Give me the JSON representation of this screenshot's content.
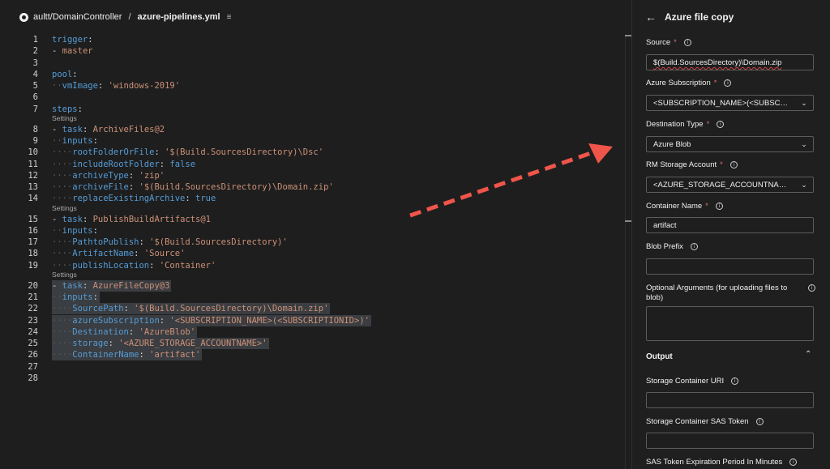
{
  "breadcrumb": {
    "repo": "aultt/DomainController",
    "separator": "/",
    "file": "azure-pipelines.yml"
  },
  "editor": {
    "lines": [
      {
        "n": "1",
        "tokens": [
          [
            "k",
            "trigger"
          ],
          [
            "p",
            ":"
          ]
        ]
      },
      {
        "n": "2",
        "tokens": [
          [
            "p",
            "- "
          ],
          [
            "s",
            "master"
          ]
        ]
      },
      {
        "n": "3",
        "tokens": []
      },
      {
        "n": "4",
        "tokens": [
          [
            "k",
            "pool"
          ],
          [
            "p",
            ":"
          ]
        ]
      },
      {
        "n": "5",
        "tokens": [
          [
            "g",
            "··"
          ],
          [
            "k",
            "vmImage"
          ],
          [
            "p",
            ": "
          ],
          [
            "s",
            "'windows-2019'"
          ]
        ]
      },
      {
        "n": "6",
        "tokens": []
      },
      {
        "n": "7",
        "tokens": [
          [
            "k",
            "steps"
          ],
          [
            "p",
            ":"
          ]
        ]
      },
      {
        "n": "8",
        "tokens": [
          [
            "p",
            "- "
          ],
          [
            "k",
            "task"
          ],
          [
            "p",
            ": "
          ],
          [
            "s",
            "ArchiveFiles@2"
          ]
        ]
      },
      {
        "n": "9",
        "tokens": [
          [
            "g",
            "··"
          ],
          [
            "k",
            "inputs"
          ],
          [
            "p",
            ":"
          ]
        ]
      },
      {
        "n": "10",
        "tokens": [
          [
            "g",
            "····"
          ],
          [
            "k",
            "rootFolderOrFile"
          ],
          [
            "p",
            ": "
          ],
          [
            "s",
            "'$(Build.SourcesDirectory)\\Dsc'"
          ]
        ]
      },
      {
        "n": "11",
        "tokens": [
          [
            "g",
            "····"
          ],
          [
            "k",
            "includeRootFolder"
          ],
          [
            "p",
            ": "
          ],
          [
            "b",
            "false"
          ]
        ]
      },
      {
        "n": "12",
        "tokens": [
          [
            "g",
            "····"
          ],
          [
            "k",
            "archiveType"
          ],
          [
            "p",
            ": "
          ],
          [
            "s",
            "'zip'"
          ]
        ]
      },
      {
        "n": "13",
        "tokens": [
          [
            "g",
            "····"
          ],
          [
            "k",
            "archiveFile"
          ],
          [
            "p",
            ": "
          ],
          [
            "s",
            "'$(Build.SourcesDirectory)\\Domain.zip'"
          ]
        ]
      },
      {
        "n": "14",
        "tokens": [
          [
            "g",
            "····"
          ],
          [
            "k",
            "replaceExistingArchive"
          ],
          [
            "p",
            ": "
          ],
          [
            "b",
            "true"
          ]
        ]
      },
      {
        "n": "15",
        "tokens": [
          [
            "p",
            "- "
          ],
          [
            "k",
            "task"
          ],
          [
            "p",
            ": "
          ],
          [
            "s",
            "PublishBuildArtifacts@1"
          ]
        ]
      },
      {
        "n": "16",
        "tokens": [
          [
            "g",
            "··"
          ],
          [
            "k",
            "inputs"
          ],
          [
            "p",
            ":"
          ]
        ]
      },
      {
        "n": "17",
        "tokens": [
          [
            "g",
            "····"
          ],
          [
            "k",
            "PathtoPublish"
          ],
          [
            "p",
            ": "
          ],
          [
            "s",
            "'$(Build.SourcesDirectory)'"
          ]
        ]
      },
      {
        "n": "18",
        "tokens": [
          [
            "g",
            "····"
          ],
          [
            "k",
            "ArtifactName"
          ],
          [
            "p",
            ": "
          ],
          [
            "s",
            "'Source'"
          ]
        ]
      },
      {
        "n": "19",
        "tokens": [
          [
            "g",
            "····"
          ],
          [
            "k",
            "publishLocation"
          ],
          [
            "p",
            ": "
          ],
          [
            "s",
            "'Container'"
          ]
        ]
      },
      {
        "n": "20",
        "tokens": [
          [
            "p",
            "- "
          ],
          [
            "k",
            "task"
          ],
          [
            "p",
            ": "
          ],
          [
            "s",
            "AzureFileCopy@3"
          ]
        ],
        "hl": true
      },
      {
        "n": "21",
        "tokens": [
          [
            "g",
            "··"
          ],
          [
            "k",
            "inputs"
          ],
          [
            "p",
            ":"
          ]
        ],
        "hl": true
      },
      {
        "n": "22",
        "tokens": [
          [
            "g",
            "····"
          ],
          [
            "k",
            "SourcePath"
          ],
          [
            "p",
            ": "
          ],
          [
            "s",
            "'$(Build.SourcesDirectory)\\Domain.zip'"
          ]
        ],
        "hl": true
      },
      {
        "n": "23",
        "tokens": [
          [
            "g",
            "····"
          ],
          [
            "k",
            "azureSubscription"
          ],
          [
            "p",
            ": "
          ],
          [
            "s",
            "'<SUBSCRIPTION_NAME>(<SUBSCRIPTIONID>)'"
          ]
        ],
        "hl": true
      },
      {
        "n": "24",
        "tokens": [
          [
            "g",
            "····"
          ],
          [
            "k",
            "Destination"
          ],
          [
            "p",
            ": "
          ],
          [
            "s",
            "'AzureBlob'"
          ]
        ],
        "hl": true
      },
      {
        "n": "25",
        "tokens": [
          [
            "g",
            "····"
          ],
          [
            "k",
            "storage"
          ],
          [
            "p",
            ": "
          ],
          [
            "s",
            "'<AZURE_STORAGE_ACCOUNTNAME>'"
          ]
        ],
        "hl": true
      },
      {
        "n": "26",
        "tokens": [
          [
            "g",
            "····"
          ],
          [
            "k",
            "ContainerName"
          ],
          [
            "p",
            ": "
          ],
          [
            "s",
            "'artifact'"
          ]
        ],
        "hl": true
      },
      {
        "n": "27",
        "tokens": []
      },
      {
        "n": "28",
        "tokens": []
      }
    ],
    "settings_label": "Settings"
  },
  "panel": {
    "title": "Azure file copy",
    "fields": {
      "source": {
        "label": "Source",
        "value": "$(Build.SourcesDirectory)\\Domain.zip"
      },
      "subscription": {
        "label": "Azure Subscription",
        "value": "<SUBSCRIPTION_NAME>(<SUBSCRIPTIONID>)"
      },
      "destination": {
        "label": "Destination Type",
        "value": "Azure Blob"
      },
      "storage": {
        "label": "RM Storage Account",
        "value": "<AZURE_STORAGE_ACCOUNTNAME>"
      },
      "container": {
        "label": "Container Name",
        "value": "artifact"
      },
      "blob_prefix": {
        "label": "Blob Prefix",
        "value": ""
      },
      "optional_args": {
        "label": "Optional Arguments (for uploading files to blob)",
        "value": ""
      },
      "output_section": "Output",
      "container_uri": {
        "label": "Storage Container URI",
        "value": ""
      },
      "sas_token": {
        "label": "Storage Container SAS Token",
        "value": ""
      },
      "sas_expiry": {
        "label": "SAS Token Expiration Period In Minutes"
      }
    },
    "required_mark": "*"
  },
  "colors": {
    "keyword": "#569cd6",
    "string": "#ce9178",
    "arrow": "#f0554a",
    "required": "#e06c6c"
  }
}
